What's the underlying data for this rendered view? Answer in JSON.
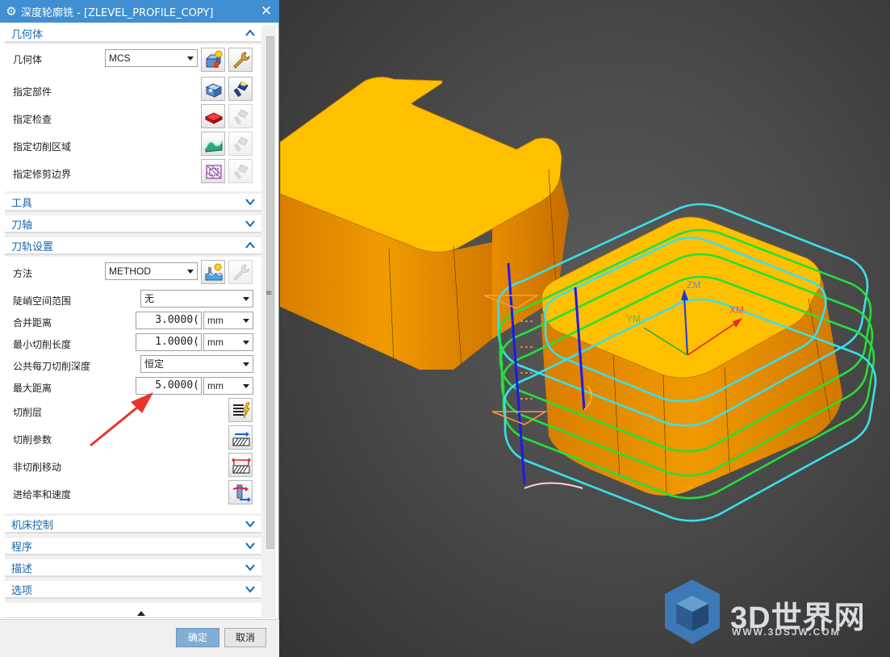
{
  "dialog": {
    "title": "深度轮廓铣 - [ZLEVEL_PROFILE_COPY]",
    "ok_label": "确定",
    "cancel_label": "取消"
  },
  "geometry": {
    "header": "几何体",
    "geometry_label": "几何体",
    "geometry_value": "MCS",
    "part_label": "指定部件",
    "check_label": "指定检查",
    "cut_area_label": "指定切削区域",
    "trim_label": "指定修剪边界"
  },
  "tool": {
    "header": "工具"
  },
  "axis": {
    "header": "刀轴"
  },
  "path": {
    "header": "刀轨设置",
    "method_label": "方法",
    "method_value": "METHOD",
    "steep_label": "陡峭空间范围",
    "steep_value": "无",
    "merge_label": "合并距离",
    "merge_value": "3.0000(",
    "merge_unit": "mm",
    "min_cut_label": "最小切削长度",
    "min_cut_value": "1.0000(",
    "min_cut_unit": "mm",
    "depth_label": "公共每刀切削深度",
    "depth_value": "恒定",
    "max_dist_label": "最大距离",
    "max_dist_value": "5.0000(",
    "max_dist_unit": "mm",
    "cut_levels_label": "切削层",
    "cut_params_label": "切削参数",
    "non_cut_label": "非切削移动",
    "feeds_label": "进给率和速度"
  },
  "machine": {
    "header": "机床控制"
  },
  "program": {
    "header": "程序"
  },
  "description": {
    "header": "描述"
  },
  "options": {
    "header": "选项"
  },
  "viewport": {
    "axis_zm": "ZM",
    "axis_xm": "XM",
    "axis_ym": "YM"
  },
  "watermark": {
    "text": "3D世界网",
    "url": "WWW.3DSJW.COM"
  },
  "colors": {
    "title_bar": "#3f8fd2",
    "group_header_text": "#1866ad",
    "part_orange": "#ffc107",
    "part_side": "#e48a00",
    "toolpath_green": "#22e03a",
    "toolpath_cyan": "#39e0ea",
    "annotation_arrow": "#e8352f"
  },
  "icons": [
    "gear-icon",
    "close-icon",
    "chevron-up-icon",
    "chevron-down-icon",
    "new-geometry-icon",
    "edit-wrench-icon",
    "part-icon",
    "flashlight-icon",
    "check-body-icon",
    "cut-area-icon",
    "trim-boundary-icon",
    "method-icon",
    "cut-levels-icon",
    "cut-params-icon",
    "non-cut-moves-icon",
    "feeds-speeds-icon"
  ]
}
